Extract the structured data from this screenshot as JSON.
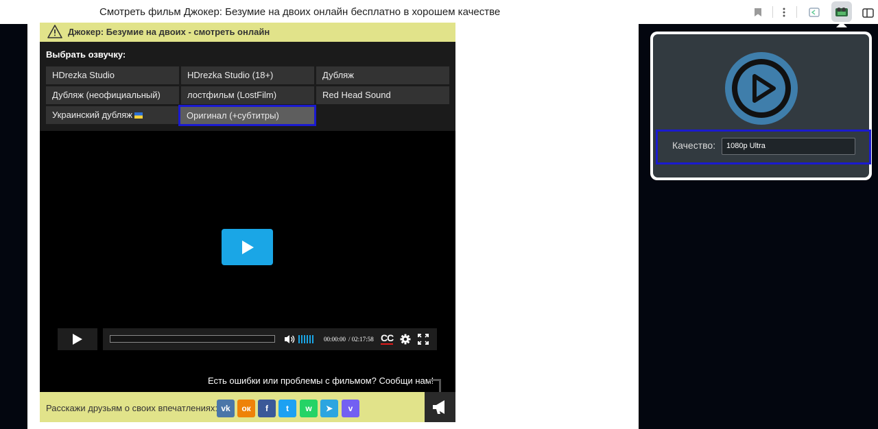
{
  "browser": {
    "tab_title": "Смотреть фильм Джокер: Безумие на двоих онлайн бесплатно в хорошем качестве"
  },
  "warning": {
    "text": "Джокер: Безумие на двоих - смотреть онлайн"
  },
  "voice": {
    "title": "Выбрать озвучку:",
    "options": [
      "HDrezka Studio",
      "HDrezka Studio (18+)",
      "Дубляж",
      "Дубляж (неофициальный)",
      "лостфильм (LostFilm)",
      "Red Head Sound",
      "Украинский дубляж",
      "Оригинал (+субтитры)"
    ],
    "selected": "Оригинал (+субтитры)"
  },
  "player": {
    "current_time": "00:00:00",
    "duration": "/ 02:17:58",
    "cc_label": "CC",
    "progress": 0,
    "report_text": "Есть ошибки или проблемы с фильмом? Сообщи нам!"
  },
  "share": {
    "label": "Расскажи друзьям о своих впечатлениях:",
    "networks": [
      {
        "name": "vk",
        "glyph": "vk",
        "color": "#4a76a8"
      },
      {
        "name": "ok",
        "glyph": "ок",
        "color": "#ee8208"
      },
      {
        "name": "facebook",
        "glyph": "f",
        "color": "#3b5998"
      },
      {
        "name": "twitter",
        "glyph": "t",
        "color": "#1da1f2"
      },
      {
        "name": "whatsapp",
        "glyph": "w",
        "color": "#25d366"
      },
      {
        "name": "telegram",
        "glyph": "➤",
        "color": "#2ca5e0"
      },
      {
        "name": "viber",
        "glyph": "v",
        "color": "#7360f2"
      }
    ]
  },
  "popup": {
    "quality_label": "Качество:",
    "quality_value": "1080p Ultra"
  },
  "colors": {
    "accent_blue": "#1aa6e6",
    "highlight_outline": "#1a1ad0",
    "warning_bg": "#e1e38a"
  }
}
